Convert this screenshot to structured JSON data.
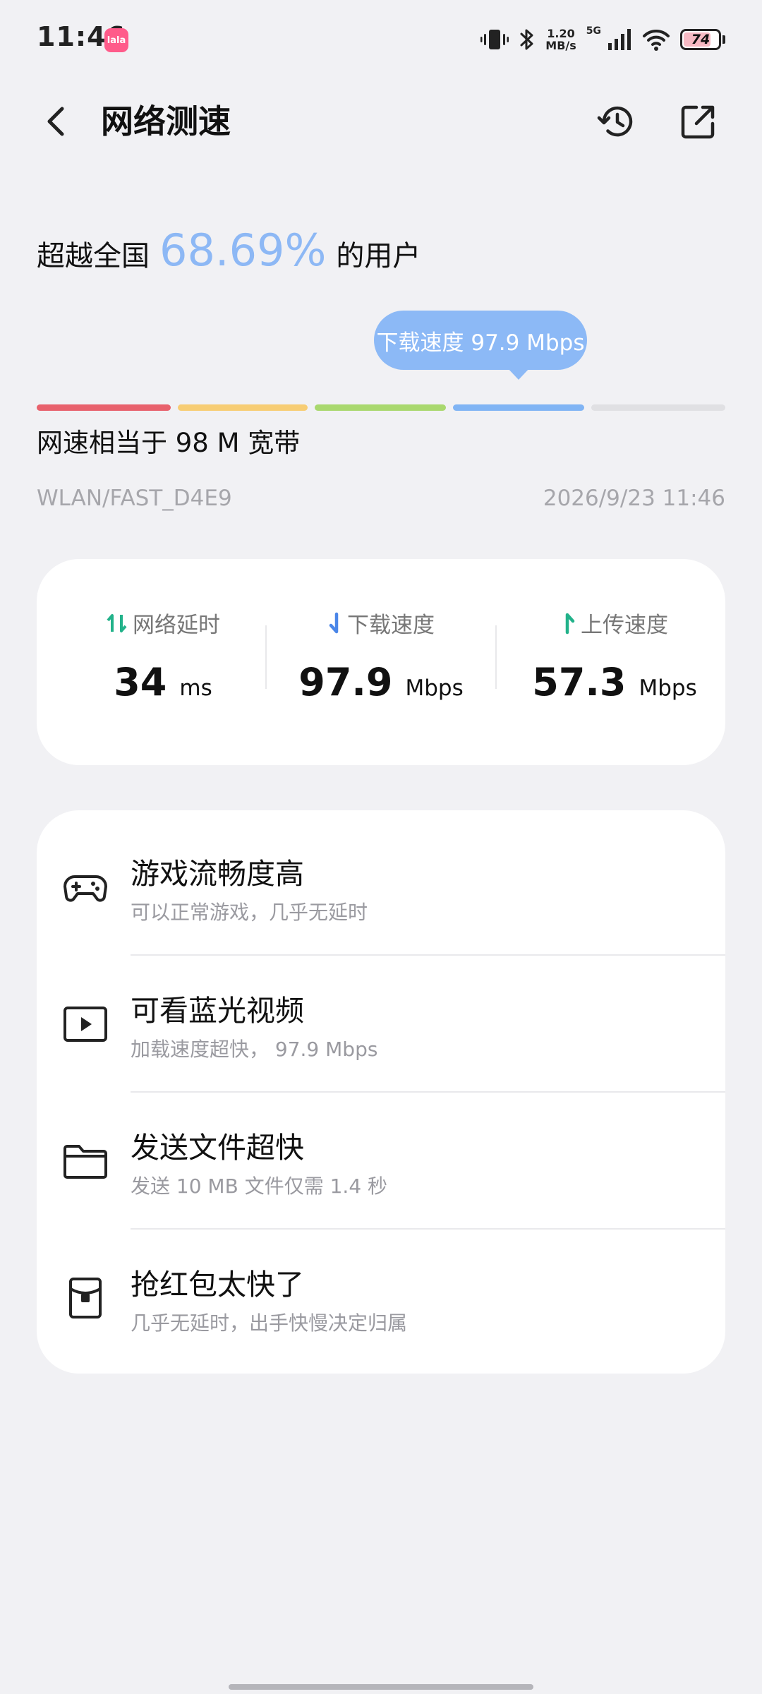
{
  "status_bar": {
    "time": "11:46",
    "app_badge": "lala",
    "net_speed_value": "1.20",
    "net_speed_unit": "MB/s",
    "network_type": "5G",
    "battery": "74",
    "battery_level": 0.74,
    "icons": [
      "vibrate-icon",
      "bluetooth-icon",
      "signal-icon",
      "wifi-icon",
      "battery-icon"
    ]
  },
  "header": {
    "title": "网络测速",
    "back_icon": "chevron-left-icon",
    "history_icon": "history-icon",
    "share_icon": "external-link-icon"
  },
  "result": {
    "prefix": "超越全国",
    "percentile": "68.69%",
    "suffix": "的用户",
    "bubble": "下载速度 97.9 Mbps",
    "equivalent": "网速相当于 98 M 宽带",
    "network": "WLAN/FAST_D4E9",
    "datetime": "2026/9/23 11:46",
    "scale_colors": [
      "#e8616c",
      "#f7cd74",
      "#a9d86e",
      "#80b4f4",
      "#e0e0e3"
    ],
    "active_segment": 3
  },
  "metrics": [
    {
      "label": "网络延时",
      "value": "34",
      "unit": "ms",
      "icon": "latency-arrows-icon",
      "color": "#22b28a"
    },
    {
      "label": "下载速度",
      "value": "97.9",
      "unit": "Mbps",
      "icon": "download-arrow-icon",
      "color": "#4a86e8"
    },
    {
      "label": "上传速度",
      "value": "57.3",
      "unit": "Mbps",
      "icon": "upload-arrow-icon",
      "color": "#22b28a"
    }
  ],
  "features": [
    {
      "title": "游戏流畅度高",
      "subtitle": "可以正常游戏，几乎无延时",
      "icon": "gamepad-icon"
    },
    {
      "title": "可看蓝光视频",
      "subtitle": "加载速度超快， 97.9 Mbps",
      "icon": "video-play-icon"
    },
    {
      "title": "发送文件超快",
      "subtitle": "发送 10 MB 文件仅需 1.4 秒",
      "icon": "folder-icon"
    },
    {
      "title": "抢红包太快了",
      "subtitle": "几乎无延时，出手快慢决定归属",
      "icon": "red-packet-icon"
    }
  ]
}
